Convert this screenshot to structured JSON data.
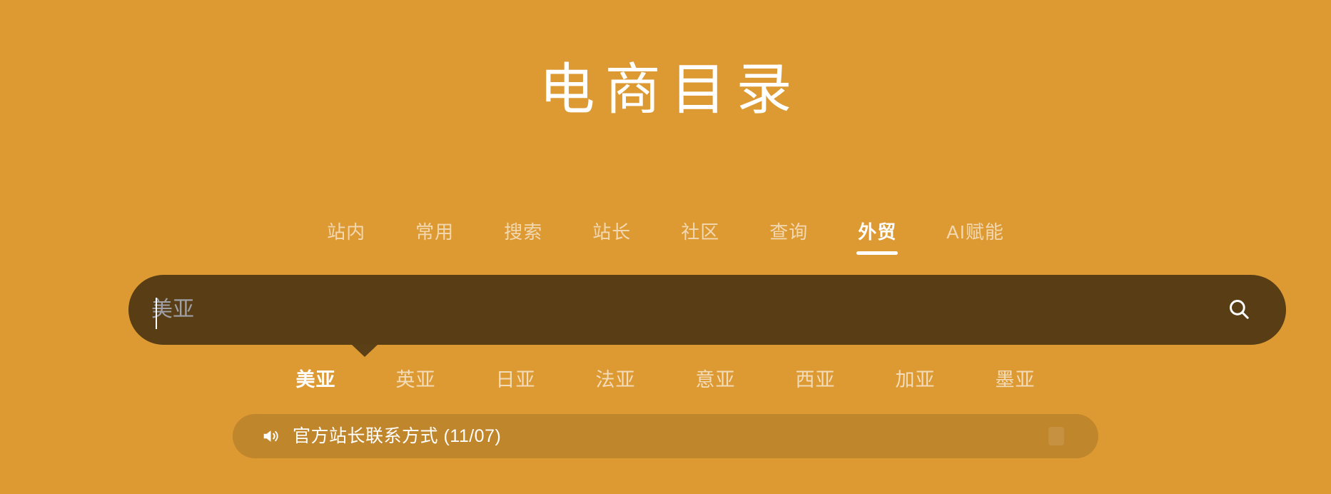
{
  "page": {
    "background_color": "#DD9A33",
    "accent_dark": "#593D15",
    "text_color": "#FFFFFF"
  },
  "header": {
    "title": "电商目录"
  },
  "nav": {
    "tabs": [
      {
        "label": "站内",
        "active": false
      },
      {
        "label": "常用",
        "active": false
      },
      {
        "label": "搜索",
        "active": false
      },
      {
        "label": "站长",
        "active": false
      },
      {
        "label": "社区",
        "active": false
      },
      {
        "label": "查询",
        "active": false
      },
      {
        "label": "外贸",
        "active": true
      },
      {
        "label": "AI赋能",
        "active": false
      }
    ]
  },
  "search": {
    "value": "",
    "placeholder": "美亚",
    "icon": "search-icon"
  },
  "sub_nav": {
    "tabs": [
      {
        "label": "美亚",
        "active": true
      },
      {
        "label": "英亚",
        "active": false
      },
      {
        "label": "日亚",
        "active": false
      },
      {
        "label": "法亚",
        "active": false
      },
      {
        "label": "意亚",
        "active": false
      },
      {
        "label": "西亚",
        "active": false
      },
      {
        "label": "加亚",
        "active": false
      },
      {
        "label": "墨亚",
        "active": false
      }
    ]
  },
  "announcement": {
    "icon": "speaker-icon",
    "text": "官方站长联系方式 (11/07)"
  }
}
